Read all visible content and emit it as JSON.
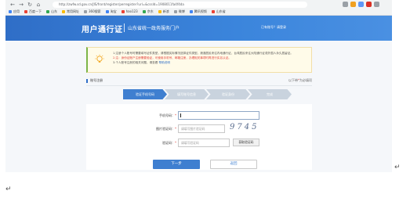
{
  "browser": {
    "address_text": "http://zwfw.sd.gov.cn/JIS/front/register/perregister?url=&cssId=1908011fa4f4da",
    "bookmarks": [
      "应用",
      "百度一下",
      "山东",
      "常用网址",
      "360搜索",
      "淘宝",
      "hao123",
      "京东",
      "新浪",
      "微博",
      "腾讯视频",
      "山东省"
    ],
    "colors": {
      "chrome": "#f1f3f4"
    }
  },
  "header": {
    "brand": "用户通行证",
    "subtitle": "山东省统一政务服务门户",
    "links": "已有账号？请登录",
    "colors": {
      "from": "#2f6ec7",
      "to": "#4a90e2"
    }
  },
  "notice": {
    "icon": "lightbulb-icon",
    "line1": "1.注册个人账号时需要填写证件类型，请根据实际情况选择证件类型。港澳居民来往内地通行证、台湾居民来往大陆通行证或外国人永久居留证。",
    "line2": "2.注：身份证账户注册需要验证，可使用手机号、邮箱注册，办理相关事项时再进行实名认证。",
    "line3_prefix": "3.个人账号注册的相关问题，请查看",
    "line3_link": "帮助说明"
  },
  "steps": {
    "heading": "账号注册",
    "required_prefix": "以下带",
    "required_star": "*",
    "required_suffix": "为必填项",
    "items": [
      "验证手机号码",
      "填写账号信息",
      "验证身份",
      "完成"
    ],
    "active_index": 0
  },
  "form": {
    "phone_label": "手机号码：",
    "phone_value": "",
    "captcha_label": "图片验证码：",
    "captcha_placeholder": "请填写图片验证码",
    "captcha_text": "9745",
    "sms_label": "验证码：",
    "sms_placeholder": "请填写验证码",
    "sms_button": "获取验证码",
    "required_mark": "*"
  },
  "actions": {
    "next": "下一步",
    "back": "返回"
  },
  "doc_marks": {
    "return_arrow": "↵"
  }
}
